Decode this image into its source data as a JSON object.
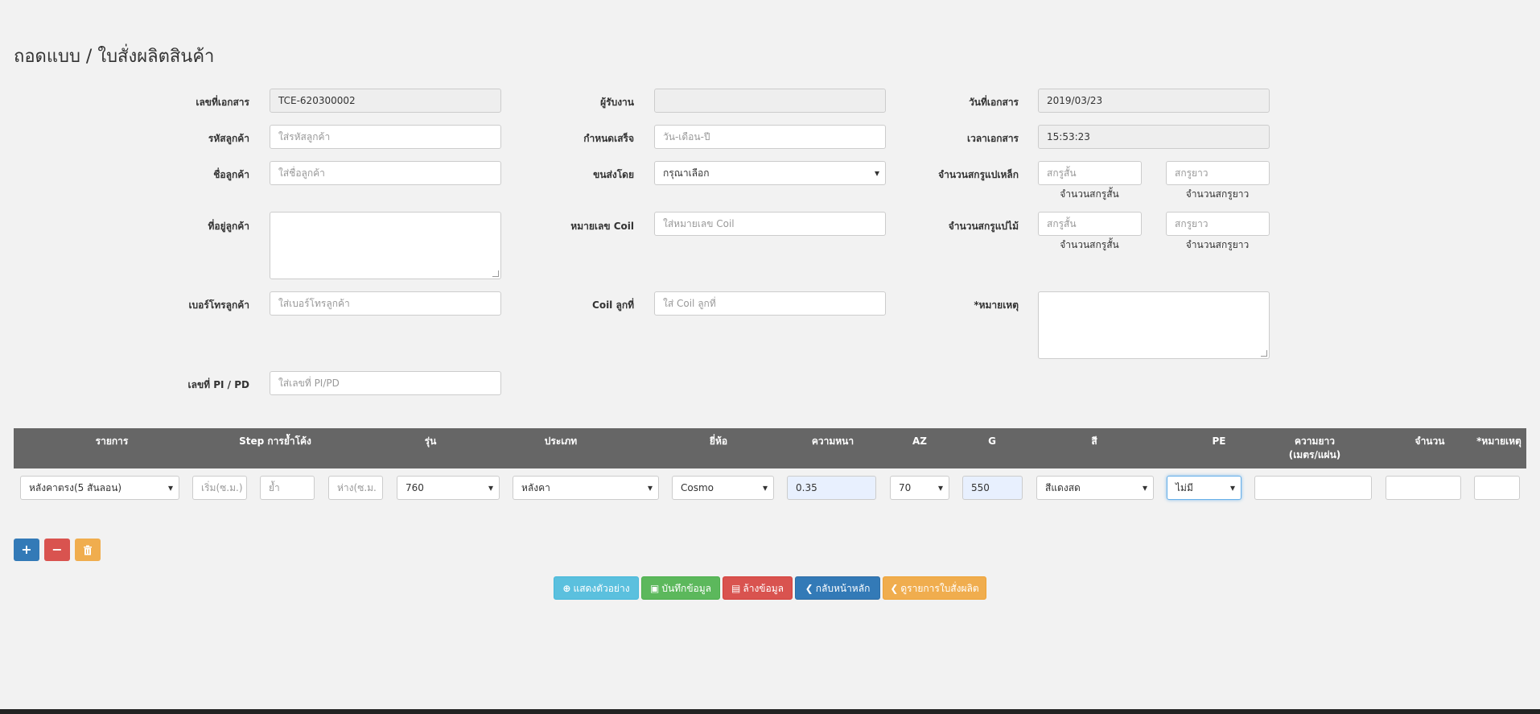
{
  "page": {
    "title": "ถอดแบบ / ใบสั่งผลิตสินค้า"
  },
  "form": {
    "doc_no": {
      "label": "เลขที่เอกสาร",
      "value": "TCE-620300002"
    },
    "receiver": {
      "label": "ผู้รับงาน",
      "value": ""
    },
    "doc_date": {
      "label": "วันที่เอกสาร",
      "value": "2019/03/23"
    },
    "customer_code": {
      "label": "รหัสลูกค้า",
      "placeholder": "ใส่รหัสลูกค้า"
    },
    "due_date": {
      "label": "กำหนดเสร็จ",
      "placeholder": "วัน-เดือน-ปี"
    },
    "doc_time": {
      "label": "เวลาเอกสาร",
      "value": "15:53:23"
    },
    "customer_name": {
      "label": "ชื่อลูกค้า",
      "placeholder": "ใส่ชื่อลูกค้า"
    },
    "shipping": {
      "label": "ขนส่งโดย",
      "value": "กรุณาเลือก"
    },
    "steel_screws": {
      "label": "จำนวนสกรูแปเหล็ก",
      "short_placeholder": "สกรูสั้น",
      "long_placeholder": "สกรูยาว",
      "short_caption": "จำนวนสกรูสั้น",
      "long_caption": "จำนวนสกรูยาว"
    },
    "address": {
      "label": "ที่อยู่ลูกค้า",
      "value": ""
    },
    "coil_no": {
      "label": "หมายเลข Coil",
      "placeholder": "ใส่หมายเลข Coil"
    },
    "wood_screws": {
      "label": "จำนวนสกรูแปไม้",
      "short_placeholder": "สกรูสั้น",
      "long_placeholder": "สกรูยาว",
      "short_caption": "จำนวนสกรูสั้น",
      "long_caption": "จำนวนสกรูยาว"
    },
    "phone": {
      "label": "เบอร์โทรลูกค้า",
      "placeholder": "ใส่เบอร์โทรลูกค้า"
    },
    "coil_piece": {
      "label": "Coil ลูกที่",
      "placeholder": "ใส่ Coil ลูกที่"
    },
    "note": {
      "label": "*หมายเหตุ",
      "value": ""
    },
    "pi_pd": {
      "label": "เลขที่ PI / PD",
      "placeholder": "ใส่เลขที่ PI/PD"
    }
  },
  "table": {
    "headers": {
      "item": "รายการ",
      "step": "Step การย้ำโค้ง",
      "model": "รุ่น",
      "type": "ประเภท",
      "brand": "ยี่ห้อ",
      "thickness": "ความหนา",
      "az": "AZ",
      "g": "G",
      "color": "สี",
      "pe": "PE",
      "length_1": "ความยาว",
      "length_2": "(เมตร/แผ่น)",
      "qty": "จำนวน",
      "note": "*หมายเหตุ"
    },
    "row": {
      "item": "หลังคาตรง(5 สันลอน)",
      "step_start_placeholder": "เริ่ม(ซ.ม.)",
      "step_press_placeholder": "ย้ำ",
      "step_gap_placeholder": "ห่าง(ซ.ม.",
      "model": "760",
      "type": "หลังคา",
      "brand": "Cosmo",
      "thickness": "0.35",
      "az": "70",
      "g": "550",
      "color": "สีแดงสด",
      "pe": "ไม่มี",
      "length": "",
      "qty": "",
      "note": ""
    }
  },
  "row_buttons": {
    "add": "+",
    "remove": "−",
    "clear_icon": "trash-icon"
  },
  "actions": {
    "preview": "แสดงตัวอย่าง",
    "save": "บันทึกข้อมูล",
    "clear": "ล้างข้อมูล",
    "home": "กลับหน้าหลัก",
    "list": "ดูรายการใบสั่งผลิต"
  },
  "colors": {
    "info": "#5bc0de",
    "success": "#5cb85c",
    "danger": "#d9534f",
    "primary": "#337ab7",
    "warning": "#f0ad4e",
    "table_header": "#666666"
  }
}
